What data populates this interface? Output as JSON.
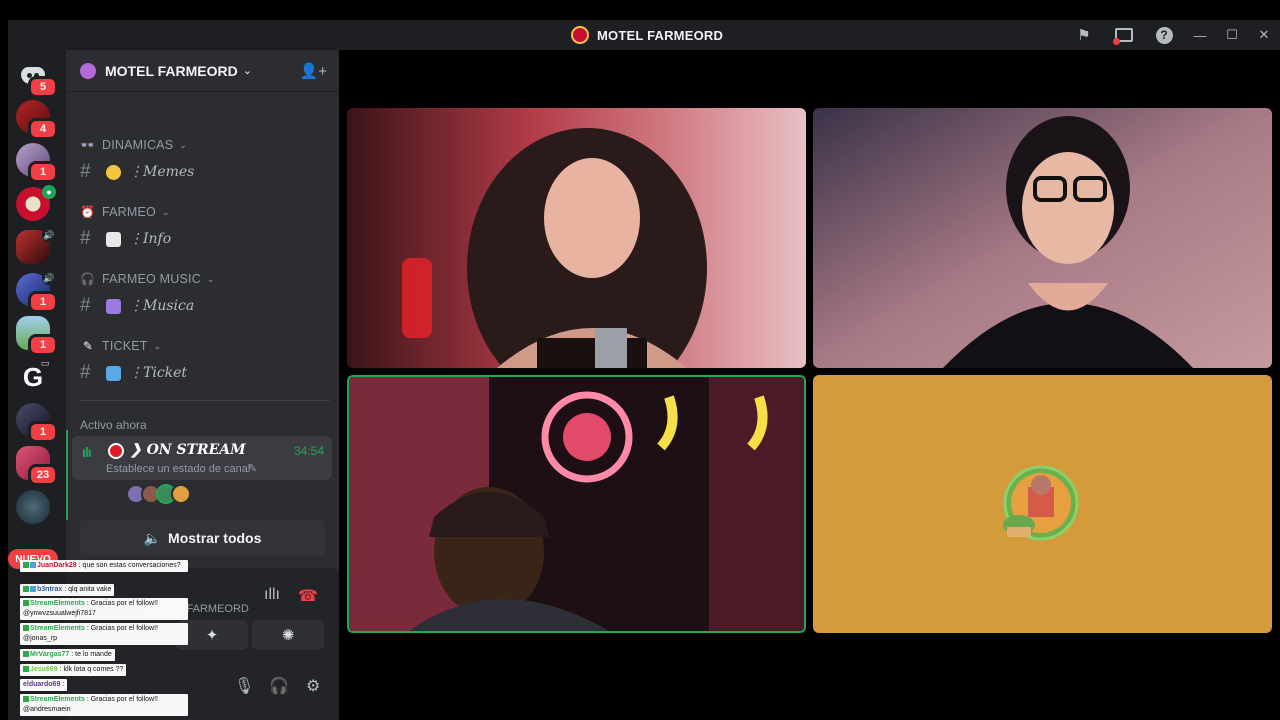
{
  "window": {
    "title": "MOTEL FARMEORD"
  },
  "rail": {
    "home_badge": "5",
    "servers": [
      {
        "name": "server-1",
        "badge": "4",
        "color": "#8b1e1e"
      },
      {
        "name": "server-2",
        "badge": "1",
        "color": "#9a7fb0"
      },
      {
        "name": "server-3",
        "badge": "",
        "color": "#c8102e"
      },
      {
        "name": "server-4",
        "badge": "",
        "color": "#7a1a1a"
      },
      {
        "name": "server-5",
        "badge": "1",
        "color": "#3a4fa0"
      },
      {
        "name": "server-6",
        "badge": "1",
        "color": "#6aa84f"
      },
      {
        "name": "server-7",
        "badge": "",
        "color": "#2a2a2a"
      },
      {
        "name": "server-8",
        "badge": "1",
        "color": "#3b3a52"
      },
      {
        "name": "server-9",
        "badge": "23",
        "color": "#c23b5a"
      },
      {
        "name": "server-10",
        "badge": "",
        "color": "#36474f"
      }
    ],
    "nuevo_label": "NUEVO"
  },
  "sidebar": {
    "server_name": "MOTEL FARMEORD",
    "categories": [
      {
        "label": "DINAMICAS",
        "icon": "👓"
      },
      {
        "label": "FARMEO",
        "icon": "⏰"
      },
      {
        "label": "FARMEO MUSIC",
        "icon": "🎧"
      },
      {
        "label": "TICKET",
        "icon": "✎"
      }
    ],
    "channels": [
      {
        "label": "⋮Memes",
        "emoji_color": "#f5c542"
      },
      {
        "label": "⋮Info",
        "emoji_color": "#e8e8e8"
      },
      {
        "label": "⋮Musica",
        "emoji_color": "#9b7be0"
      },
      {
        "label": "⋮Ticket",
        "emoji_color": "#5aa9e6"
      }
    ],
    "active_now_label": "Activo ahora",
    "activity": {
      "title": "❯ ON STREAM",
      "time": "34:54",
      "subtitle": "Establece un estado de canal"
    },
    "show_all_label": "Mostrar todos",
    "voice_status": "MOTEL FARMEORD"
  },
  "chat": [
    {
      "user": "JuanDark28",
      "text": ": que son estas conversaciones?"
    },
    {
      "user": "b3ntrax",
      "text": ": qlq anita vake"
    },
    {
      "user": "StreamElements",
      "text": ": Gracias por el follow!! @ynwvzsuualwejfi7817"
    },
    {
      "user": "StreamElements",
      "text": ": Gracias por el follow!! @jonas_rp"
    },
    {
      "user": "MrVargas77",
      "text": ": te lo mande"
    },
    {
      "user": "Jesu669",
      "text": ": klk lota q comes ??"
    },
    {
      "user": "elduardo69",
      "text": ":"
    },
    {
      "user": "StreamElements",
      "text": ": Gracias por el follow!! @andresmaein"
    }
  ],
  "colors": {
    "accent_green": "#23a559",
    "badge_red": "#f23f43",
    "stage_yellow": "#d39b3a"
  }
}
